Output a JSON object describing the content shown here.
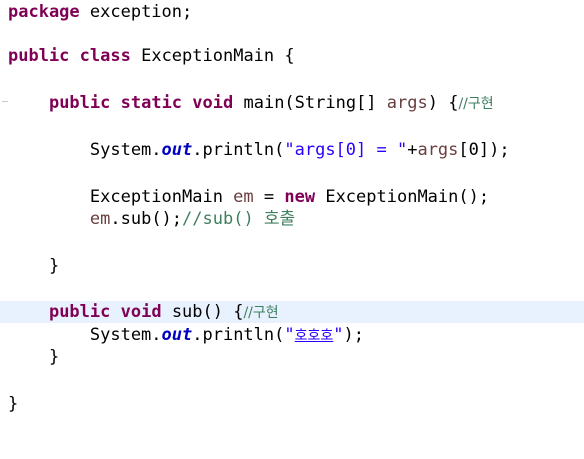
{
  "editor": {
    "lines": {
      "l1": {
        "kw_package": "package",
        "rest": " exception;"
      },
      "l2": {
        "kw_public": "public",
        "kw_class": "class",
        "rest": " ExceptionMain {"
      },
      "l3": {
        "indent": "    ",
        "kw_public": "public",
        "kw_static": "static",
        "kw_void": "void",
        "mid": " main(String[] ",
        "param": "args",
        "post": ") {",
        "comment": "//구현"
      },
      "l4": {
        "indent": "        System.",
        "field": "out",
        "mid": ".println(",
        "str": "\"args[0] = \"",
        "plus": "+",
        "var": "args",
        "end": "[0]);"
      },
      "l5": {
        "indent": "        ExceptionMain ",
        "var": "em",
        "eq": " = ",
        "kw_new": "new",
        "end": " ExceptionMain();"
      },
      "l6": {
        "indent": "        ",
        "var": "em",
        "mid": ".sub();",
        "comment": "//sub() 호출"
      },
      "l7": {
        "text": "    }"
      },
      "l8": {
        "indent": "    ",
        "kw_public": "public",
        "kw_void": "void",
        "mid": " sub() {",
        "comment": "//구현"
      },
      "l9": {
        "indent": "        System.",
        "field": "out",
        "mid": ".println(",
        "q1": "\"",
        "str": "호호호",
        "q2": "\"",
        "end": ");"
      },
      "l10": {
        "text": "    }"
      },
      "l11": {
        "text": "}"
      }
    },
    "colors": {
      "keyword": "#7f0055",
      "string": "#2a00ff",
      "comment": "#3f7f5f",
      "local_variable": "#6a3e3e",
      "static_field": "#0000c0",
      "current_line": "#e8f2fe"
    }
  }
}
